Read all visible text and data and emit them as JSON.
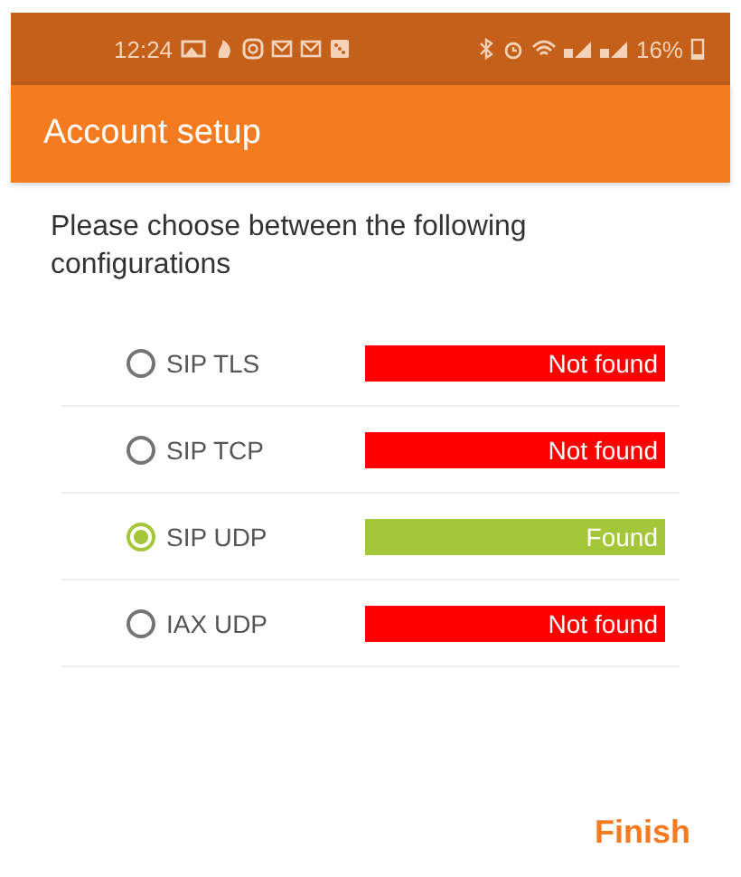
{
  "status_bar": {
    "time": "12:24",
    "battery": "16%"
  },
  "app_bar": {
    "title": "Account setup"
  },
  "prompt": "Please choose between the following configurations",
  "configurations": [
    {
      "label": "SIP TLS",
      "selected": false,
      "status": "Not found",
      "color": "#ff0000"
    },
    {
      "label": "SIP TCP",
      "selected": false,
      "status": "Not found",
      "color": "#ff0000"
    },
    {
      "label": "SIP UDP",
      "selected": true,
      "status": "Found",
      "color": "#a4c639"
    },
    {
      "label": "IAX UDP",
      "selected": false,
      "status": "Not found",
      "color": "#ff0000"
    }
  ],
  "finish_button": "Finish"
}
